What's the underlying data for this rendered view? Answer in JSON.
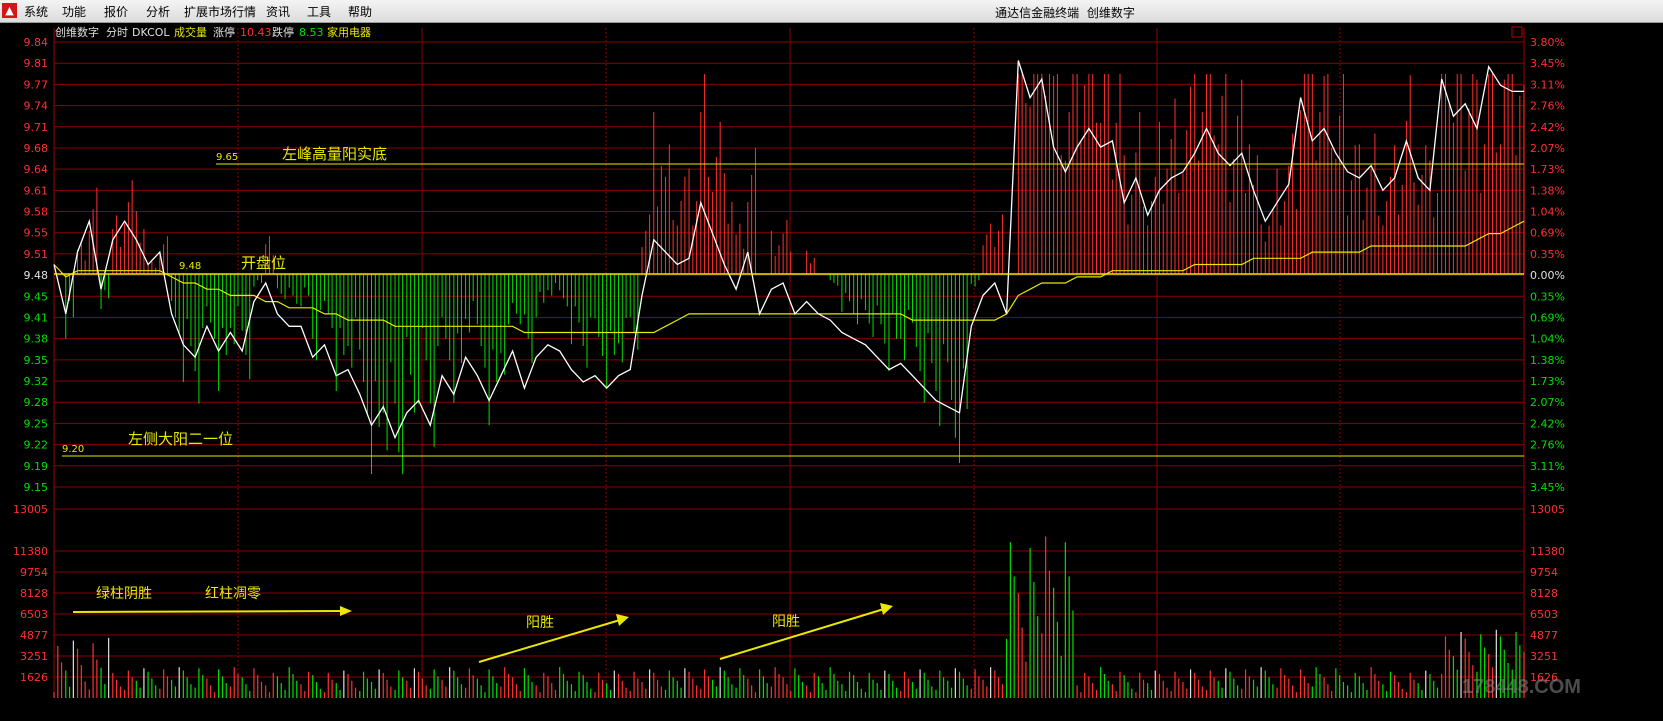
{
  "menu": {
    "items": [
      "系统",
      "功能",
      "报价",
      "分析",
      "扩展市场行情",
      "资讯",
      "工具",
      "帮助"
    ],
    "title": "通达信金融终端",
    "stock": "创维数字"
  },
  "header": {
    "name": "创维数字",
    "mode": "分时",
    "code": "DKCOL",
    "volume_label": "成交量",
    "limit_up_label": "涨停",
    "limit_up_value": "10.43",
    "limit_down_label": "跌停",
    "limit_down_value": "8.53",
    "sector": "家用电器"
  },
  "annotations": {
    "line_965": "9.65",
    "text_965": "左峰高量阳实底",
    "line_948": "9.48",
    "text_948": "开盘位",
    "line_920": "9.20",
    "text_920": "左侧大阳二一位",
    "volume_text_1": "绿柱阴胜",
    "volume_text_2": "红柱凋零",
    "arrow_text_1": "阳胜",
    "arrow_text_2": "阳胜"
  },
  "watermark": "178448.COM",
  "colors": {
    "up": "#ff3030",
    "down": "#00e000",
    "price": "#ffffff",
    "avg": "#e8e800",
    "grid": "#8a0000",
    "annot": "#e8e800"
  },
  "chart_data": {
    "type": "line",
    "title": "创维数字 分时",
    "prev_close": 9.48,
    "price_ticks": [
      "9.84",
      "9.81",
      "9.77",
      "9.74",
      "9.71",
      "9.68",
      "9.64",
      "9.61",
      "9.58",
      "9.55",
      "9.51",
      "9.48",
      "9.45",
      "9.41",
      "9.38",
      "9.35",
      "9.32",
      "9.28",
      "9.25",
      "9.22",
      "9.19",
      "9.15"
    ],
    "pct_ticks": [
      "3.80%",
      "3.45%",
      "3.11%",
      "2.76%",
      "2.42%",
      "2.07%",
      "1.73%",
      "1.38%",
      "1.04%",
      "0.69%",
      "0.35%",
      "0.00%",
      "0.35%",
      "0.69%",
      "1.04%",
      "1.38%",
      "1.73%",
      "2.07%",
      "2.42%",
      "2.76%",
      "3.11%",
      "3.45%"
    ],
    "volume_ticks": [
      "13005",
      "11380",
      "9754",
      "8128",
      "6503",
      "4877",
      "3251",
      "1626"
    ],
    "price_ylim": [
      9.12,
      9.84
    ],
    "volume_ylim": [
      0,
      13005
    ],
    "price": [
      9.48,
      9.4,
      9.5,
      9.55,
      9.44,
      9.52,
      9.55,
      9.52,
      9.48,
      9.5,
      9.4,
      9.35,
      9.33,
      9.38,
      9.34,
      9.37,
      9.34,
      9.42,
      9.45,
      9.4,
      9.38,
      9.38,
      9.33,
      9.35,
      9.3,
      9.31,
      9.27,
      9.22,
      9.25,
      9.2,
      9.24,
      9.26,
      9.22,
      9.3,
      9.27,
      9.33,
      9.3,
      9.26,
      9.3,
      9.34,
      9.28,
      9.33,
      9.35,
      9.34,
      9.31,
      9.29,
      9.3,
      9.28,
      9.3,
      9.31,
      9.43,
      9.52,
      9.5,
      9.48,
      9.49,
      9.58,
      9.53,
      9.48,
      9.44,
      9.5,
      9.4,
      9.44,
      9.45,
      9.4,
      9.42,
      9.4,
      9.39,
      9.37,
      9.36,
      9.35,
      9.33,
      9.31,
      9.32,
      9.3,
      9.28,
      9.26,
      9.25,
      9.24,
      9.38,
      9.43,
      9.45,
      9.4,
      9.81,
      9.75,
      9.78,
      9.67,
      9.63,
      9.67,
      9.7,
      9.67,
      9.68,
      9.58,
      9.62,
      9.56,
      9.6,
      9.62,
      9.63,
      9.66,
      9.7,
      9.66,
      9.64,
      9.66,
      9.6,
      9.55,
      9.58,
      9.61,
      9.75,
      9.68,
      9.7,
      9.66,
      9.63,
      9.62,
      9.64,
      9.6,
      9.62,
      9.68,
      9.62,
      9.6,
      9.78,
      9.72,
      9.74,
      9.7,
      9.8,
      9.77,
      9.76,
      9.76
    ],
    "avg": [
      9.48,
      9.46,
      9.47,
      9.47,
      9.47,
      9.47,
      9.47,
      9.47,
      9.47,
      9.47,
      9.46,
      9.45,
      9.45,
      9.44,
      9.44,
      9.43,
      9.43,
      9.43,
      9.42,
      9.42,
      9.41,
      9.41,
      9.41,
      9.4,
      9.4,
      9.39,
      9.39,
      9.39,
      9.39,
      9.38,
      9.38,
      9.38,
      9.38,
      9.38,
      9.38,
      9.38,
      9.38,
      9.38,
      9.38,
      9.38,
      9.37,
      9.37,
      9.37,
      9.37,
      9.37,
      9.37,
      9.37,
      9.37,
      9.37,
      9.37,
      9.37,
      9.37,
      9.38,
      9.39,
      9.4,
      9.4,
      9.4,
      9.4,
      9.4,
      9.4,
      9.4,
      9.4,
      9.4,
      9.4,
      9.4,
      9.4,
      9.4,
      9.4,
      9.4,
      9.4,
      9.4,
      9.4,
      9.4,
      9.39,
      9.39,
      9.39,
      9.39,
      9.39,
      9.39,
      9.39,
      9.39,
      9.4,
      9.43,
      9.44,
      9.45,
      9.45,
      9.45,
      9.46,
      9.46,
      9.46,
      9.47,
      9.47,
      9.47,
      9.47,
      9.47,
      9.47,
      9.47,
      9.48,
      9.48,
      9.48,
      9.48,
      9.48,
      9.49,
      9.49,
      9.49,
      9.49,
      9.49,
      9.5,
      9.5,
      9.5,
      9.5,
      9.5,
      9.51,
      9.51,
      9.51,
      9.51,
      9.51,
      9.51,
      9.51,
      9.51,
      9.51,
      9.52,
      9.53,
      9.53,
      9.54,
      9.55
    ]
  }
}
